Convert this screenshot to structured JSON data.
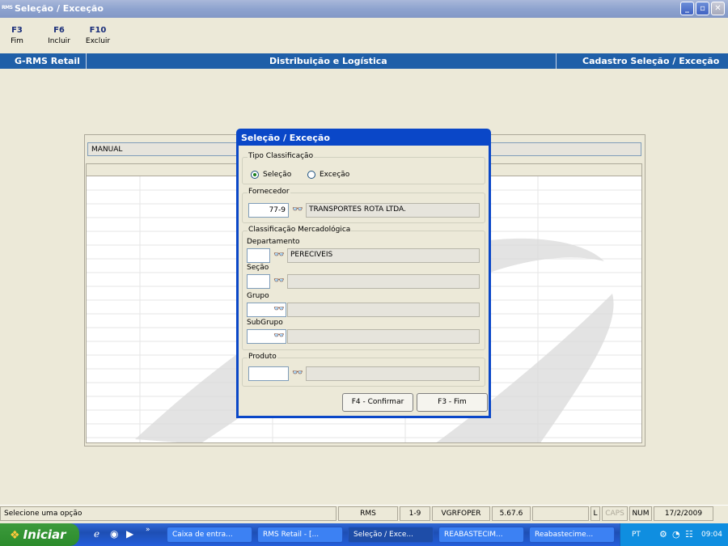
{
  "window": {
    "icon_text": "RMS",
    "title": "Seleção / Exceção"
  },
  "toolbar": [
    {
      "key": "F3",
      "label": "Fim"
    },
    {
      "key": "F6",
      "label": "Incluir"
    },
    {
      "key": "F10",
      "label": "Excluir"
    }
  ],
  "header": {
    "left": "G-RMS Retail",
    "center": "Distribuição e Logística",
    "right": "Cadastro Seleção / Exceção"
  },
  "main": {
    "manual_value": "MANUAL"
  },
  "dialog": {
    "title": "Seleção / Exceção",
    "tipo": {
      "legend": "Tipo Classificação",
      "option_selecao": "Seleção",
      "option_excecao": "Exceção",
      "selected": "Seleção"
    },
    "fornecedor": {
      "legend": "Fornecedor",
      "code": "77-9",
      "name": "TRANSPORTES ROTA LTDA."
    },
    "classificacao": {
      "legend": "Classificação Mercadológica",
      "departamento_label": "Departamento",
      "departamento_code": "",
      "departamento_name": "PERECIVEIS",
      "secao_label": "Seção",
      "grupo_label": "Grupo",
      "subgrupo_label": "SubGrupo"
    },
    "produto": {
      "legend": "Produto"
    },
    "buttons": {
      "confirm": "F4 - Confirmar",
      "end": "F3 - Fim"
    }
  },
  "statusbar": {
    "message": "Selecione uma opção",
    "system": "RMS",
    "range": "1-9",
    "program": "VGRFOPER",
    "version": "5.67.6",
    "ind_l": "L",
    "ind_caps": "CAPS",
    "ind_num": "NUM",
    "date": "17/2/2009"
  },
  "taskbar": {
    "start_label": "Iniciar",
    "chevron": "»",
    "tasks": [
      "Caixa de entra...",
      "RMS Retail - [...",
      "Seleção / Exce...",
      "REABASTECIM...",
      "Reabastecime..."
    ],
    "language": "PT",
    "clock": "09:04"
  },
  "colors": {
    "header_band": "#1f5fa8",
    "dialog_frame": "#0a47c8",
    "title_bar": "#8ea3cf"
  }
}
